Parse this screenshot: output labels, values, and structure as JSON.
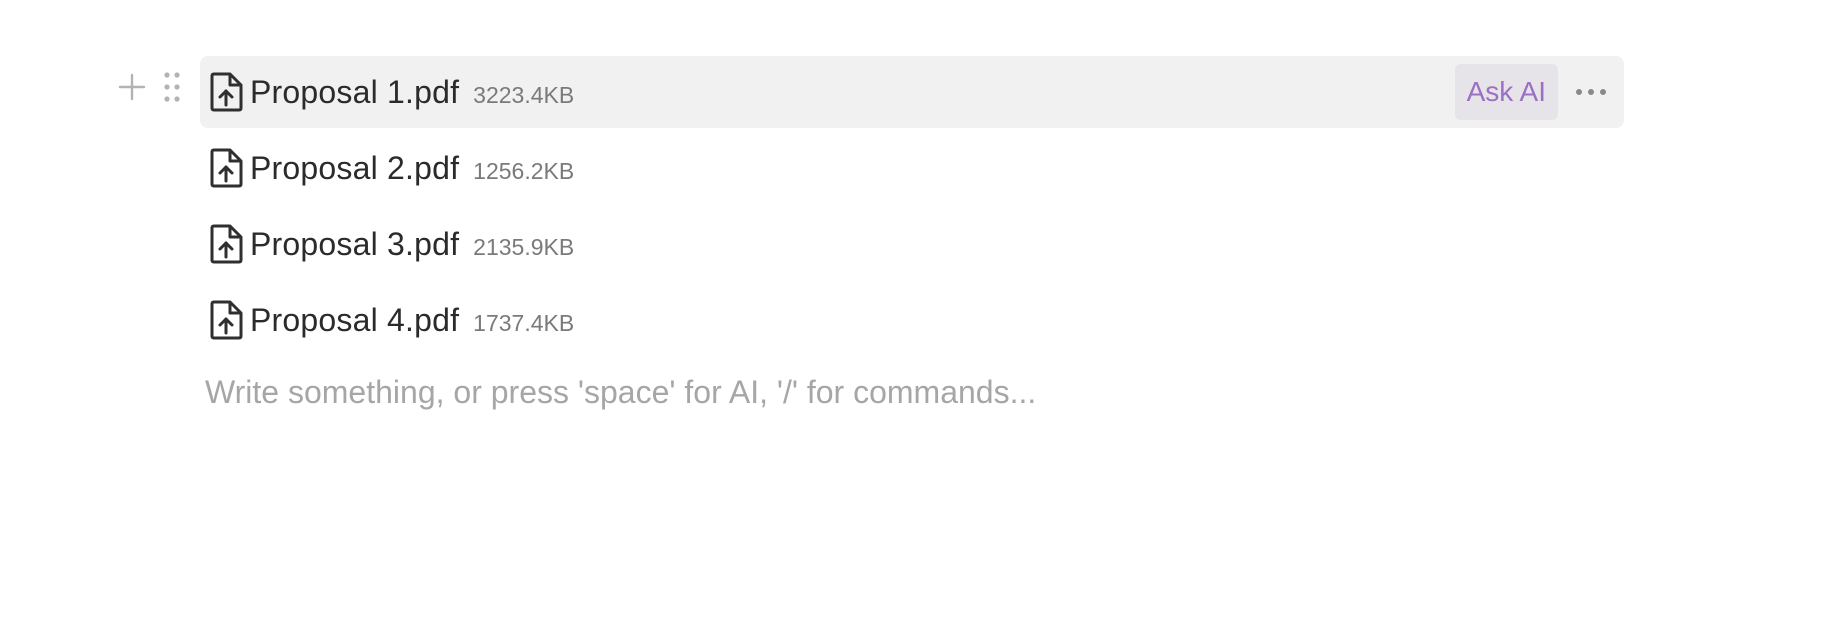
{
  "block_controls": {
    "add_icon": "plus-icon",
    "drag_icon": "drag-handle-icon"
  },
  "files": [
    {
      "name": "Proposal 1.pdf",
      "size": "3223.4KB",
      "icon": "file-upload-icon"
    },
    {
      "name": "Proposal 2.pdf",
      "size": "1256.2KB",
      "icon": "file-upload-icon"
    },
    {
      "name": "Proposal 3.pdf",
      "size": "2135.9KB",
      "icon": "file-upload-icon"
    },
    {
      "name": "Proposal 4.pdf",
      "size": "1737.4KB",
      "icon": "file-upload-icon"
    }
  ],
  "row_actions": {
    "ask_ai_label": "Ask AI",
    "more_icon": "more-horizontal-icon"
  },
  "editor": {
    "placeholder": "Write something, or press 'space' for AI, '/' for commands..."
  },
  "colors": {
    "hover_background": "#f1f1f1",
    "ask_ai_text": "#9b6fc4",
    "ask_ai_background": "#e6e4e8",
    "placeholder": "#a6a6a6"
  }
}
